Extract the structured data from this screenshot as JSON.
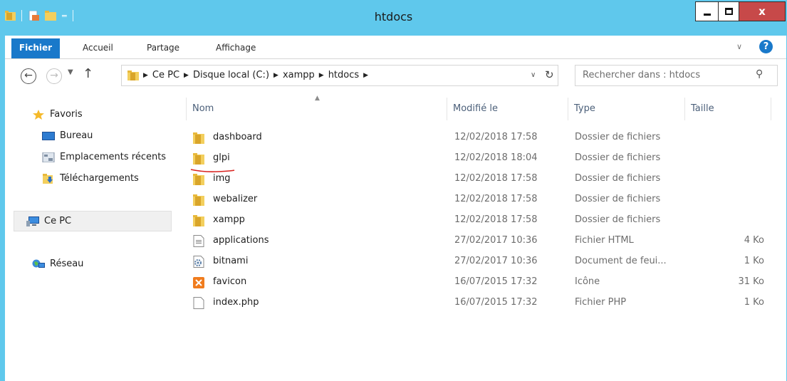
{
  "window": {
    "title": "htdocs",
    "close_label": "x"
  },
  "ribbon": {
    "tabs": [
      {
        "label": "Fichier",
        "active": true
      },
      {
        "label": "Accueil"
      },
      {
        "label": "Partage"
      },
      {
        "label": "Affichage"
      }
    ],
    "help_label": "?"
  },
  "navigation": {
    "breadcrumb": [
      "Ce PC",
      "Disque local (C:)",
      "xampp",
      "htdocs"
    ],
    "search_placeholder": "Rechercher dans : htdocs"
  },
  "sidebar": {
    "favoris": {
      "label": "Favoris",
      "items": [
        "Bureau",
        "Emplacements récents",
        "Téléchargements"
      ]
    },
    "ce_pc": "Ce PC",
    "reseau": "Réseau"
  },
  "columns": {
    "name": "Nom",
    "modified": "Modifié le",
    "type": "Type",
    "size": "Taille"
  },
  "files": [
    {
      "name": "dashboard",
      "modified": "12/02/2018 17:58",
      "type": "Dossier de fichiers",
      "size": "",
      "icon": "folder-icon"
    },
    {
      "name": "glpi",
      "modified": "12/02/2018 18:04",
      "type": "Dossier de fichiers",
      "size": "",
      "icon": "folder-icon"
    },
    {
      "name": "img",
      "modified": "12/02/2018 17:58",
      "type": "Dossier de fichiers",
      "size": "",
      "icon": "folder-icon"
    },
    {
      "name": "webalizer",
      "modified": "12/02/2018 17:58",
      "type": "Dossier de fichiers",
      "size": "",
      "icon": "folder-icon"
    },
    {
      "name": "xampp",
      "modified": "12/02/2018 17:58",
      "type": "Dossier de fichiers",
      "size": "",
      "icon": "folder-icon"
    },
    {
      "name": "applications",
      "modified": "27/02/2017 10:36",
      "type": "Fichier HTML",
      "size": "4 Ko",
      "icon": "html-file-icon"
    },
    {
      "name": "bitnami",
      "modified": "27/02/2017 10:36",
      "type": "Document de feui...",
      "size": "1 Ko",
      "icon": "css-file-icon"
    },
    {
      "name": "favicon",
      "modified": "16/07/2015 17:32",
      "type": "Icône",
      "size": "31 Ko",
      "icon": "xampp-icon"
    },
    {
      "name": "index.php",
      "modified": "16/07/2015 17:32",
      "type": "Fichier PHP",
      "size": "1 Ko",
      "icon": "file-icon"
    }
  ],
  "colors": {
    "titlebar": "#5fc8ec",
    "accent": "#1979ca",
    "close": "#c74949",
    "folder": "#e8b93c",
    "annotation": "#d9231f"
  }
}
